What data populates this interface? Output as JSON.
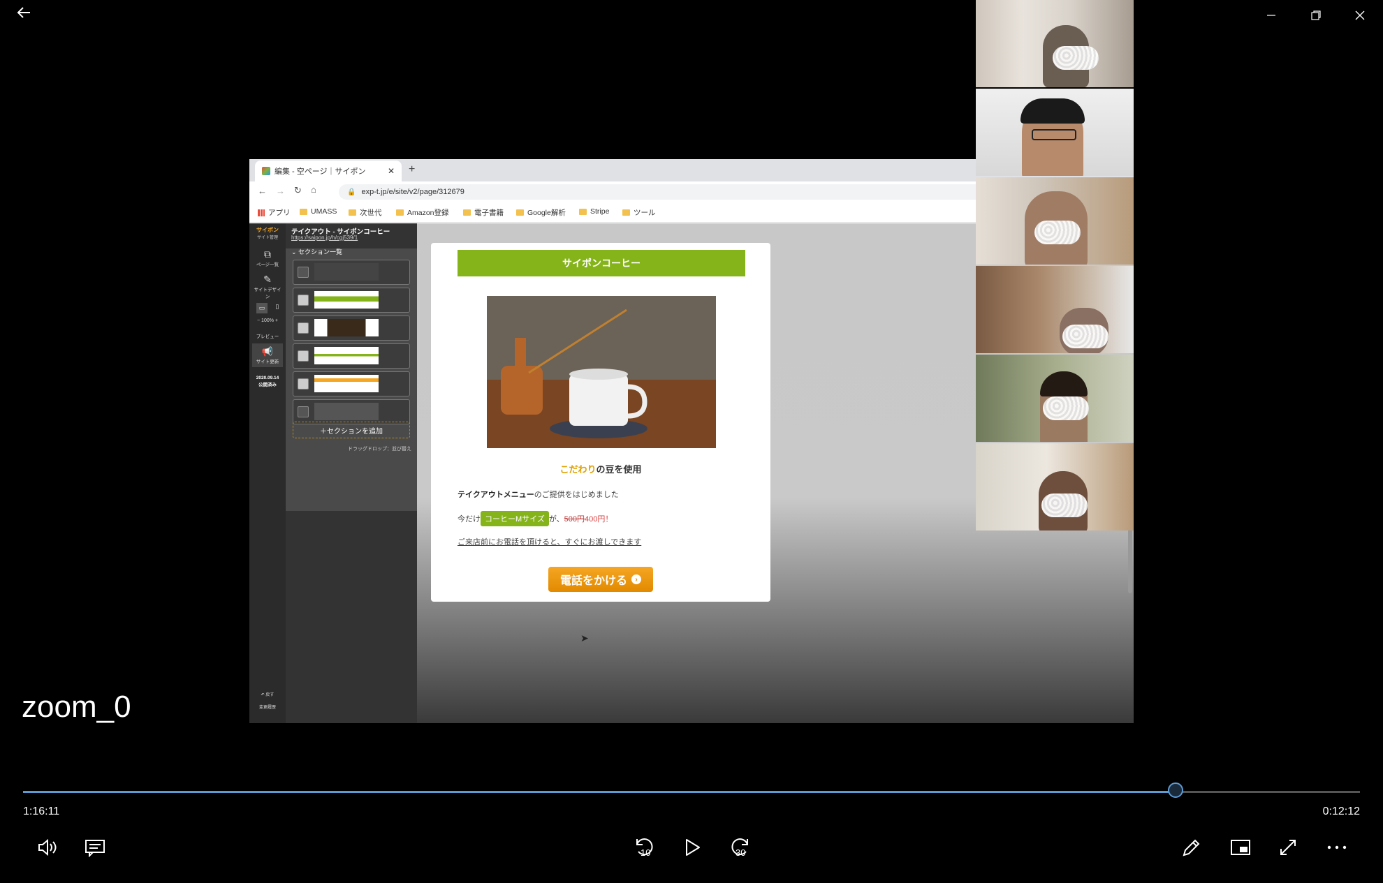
{
  "window": {
    "back_icon": "back-arrow-icon",
    "minimize_icon": "minimize-icon",
    "restore_icon": "restore-icon",
    "close_icon": "close-icon"
  },
  "browser": {
    "tab_title": "編集 - 空ページ｜サイポン",
    "url": "exp-t.jp/e/site/v2/page/312679",
    "bookmarks": [
      "アプリ",
      "UMASS",
      "次世代",
      "Amazon登録",
      "電子書籍",
      "Google解析",
      "Stripe",
      "ツール"
    ]
  },
  "editor": {
    "rail": {
      "logo": "サイポン",
      "logo_sub": "サイト管理",
      "pages": "ページ一覧",
      "design": "サイトデザイン",
      "zoom": "100%",
      "preview": "プレビュー",
      "update": "サイト更新",
      "published_date": "2020.09.14",
      "published_label": "公開済み",
      "undo": "戻す",
      "history": "変更履歴"
    },
    "panel": {
      "site_title": "テイクアウト - サイポンコーヒー",
      "site_url": "https://saipon.jp/h/cgj539/1",
      "sections_label": "セクション一覧",
      "add_section": "セクションを追加",
      "drag_hint": "ドラッグドロップ：並び替え"
    },
    "page": {
      "header": "サイポンコーヒー",
      "tagline_highlight": "こだわり",
      "tagline_rest": "の豆を使用",
      "line1_bold": "テイクアウトメニュー",
      "line1_rest": "のご提供をはじめました",
      "line2_prefix": "今だけ",
      "line2_badge": "コーヒーMサイズ",
      "line2_mid": "が、",
      "line2_old_price": "500円",
      "line2_new_price": "400円！",
      "line3": "ご来店前にお電話を頂けると、すぐにお渡しできます",
      "cta": "電話をかける"
    }
  },
  "player": {
    "title": "zoom_0",
    "elapsed": "1:16:11",
    "remaining": "0:12:12",
    "progress": 0.862,
    "skip_back": "10",
    "skip_forward": "30"
  },
  "colors": {
    "accent": "#84b31a",
    "cta": "#f29a12",
    "seek": "#5b9bd5"
  }
}
